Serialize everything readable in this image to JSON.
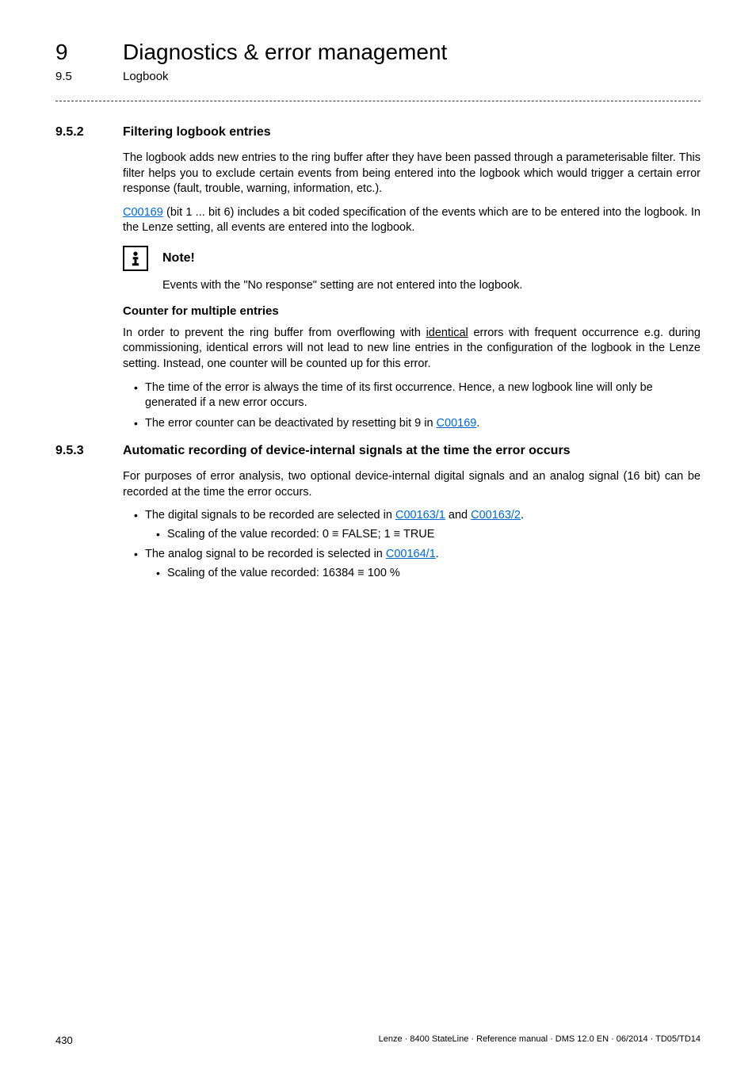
{
  "header": {
    "chapterNumber": "9",
    "chapterTitle": "Diagnostics & error management",
    "subNumber": "9.5",
    "subTitle": "Logbook"
  },
  "section952": {
    "number": "9.5.2",
    "title": "Filtering logbook entries",
    "para1": "The logbook adds new entries to the ring buffer after they have been passed through a parameterisable filter. This filter helps you to exclude certain events from being entered into the logbook which would trigger a certain error response (fault, trouble, warning, information, etc.).",
    "para2_link": "C00169",
    "para2_rest": " (bit 1 ... bit 6) includes a bit coded specification of the events which are to be entered into the logbook. In the Lenze setting, all events are entered into the logbook.",
    "note_title": "Note!",
    "note_body": "Events with the \"No response\" setting are not entered into the logbook.",
    "counter_heading": "Counter for multiple entries",
    "counter_para_a": "In order to prevent the ring buffer from overflowing with ",
    "counter_para_underline": "identical",
    "counter_para_b": " errors with frequent occurrence e.g. during commissioning, identical errors will not lead to new line entries in the configuration of the logbook in the Lenze setting. Instead, one counter will be counted up for this error.",
    "bullet1": "The time of the error is always the time of its first occurrence. Hence, a new logbook line will only be generated if a new error occurs.",
    "bullet2_a": "The error counter can be deactivated by resetting bit 9 in ",
    "bullet2_link": "C00169",
    "bullet2_b": "."
  },
  "section953": {
    "number": "9.5.3",
    "title": "Automatic recording of device-internal signals at the time the error occurs",
    "para1": "For purposes of error analysis, two optional device-internal digital signals and an analog signal (16 bit) can be recorded at the time the error occurs.",
    "b1_a": "The digital signals to be recorded are selected in ",
    "b1_link1": "C00163/1",
    "b1_mid": " and ",
    "b1_link2": "C00163/2",
    "b1_end": ".",
    "b1_sub": "Scaling of the value recorded: 0 ≡ FALSE; 1 ≡ TRUE",
    "b2_a": "The analog signal to be recorded is selected in ",
    "b2_link": "C00164/1",
    "b2_end": ".",
    "b2_sub": "Scaling of the value recorded: 16384 ≡ 100 %"
  },
  "footer": {
    "page": "430",
    "ref": "Lenze · 8400 StateLine · Reference manual · DMS 12.0 EN · 06/2014 · TD05/TD14"
  }
}
